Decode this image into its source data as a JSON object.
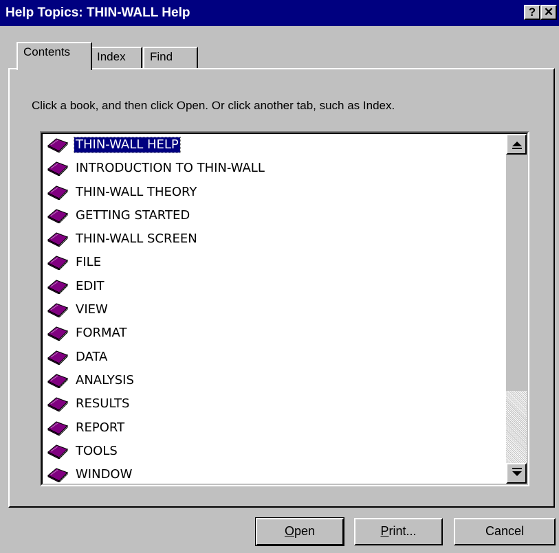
{
  "window": {
    "title": "Help Topics: THIN-WALL Help",
    "help_button": "?",
    "close_button": "✕"
  },
  "tabs": [
    {
      "label": "Contents",
      "active": true
    },
    {
      "label": "Index",
      "active": false
    },
    {
      "label": "Find",
      "active": false
    }
  ],
  "instruction": "Click a book, and then click Open. Or click another tab, such as Index.",
  "topics": [
    {
      "label": "THIN-WALL HELP",
      "icon": "book-icon",
      "selected": true
    },
    {
      "label": "INTRODUCTION TO THIN-WALL",
      "icon": "book-icon"
    },
    {
      "label": "THIN-WALL THEORY",
      "icon": "book-icon"
    },
    {
      "label": "GETTING STARTED",
      "icon": "book-icon"
    },
    {
      "label": "THIN-WALL SCREEN",
      "icon": "book-icon"
    },
    {
      "label": "FILE",
      "icon": "book-icon"
    },
    {
      "label": "EDIT",
      "icon": "book-icon"
    },
    {
      "label": "VIEW",
      "icon": "book-icon"
    },
    {
      "label": "FORMAT",
      "icon": "book-icon"
    },
    {
      "label": "DATA",
      "icon": "book-icon"
    },
    {
      "label": "ANALYSIS",
      "icon": "book-icon"
    },
    {
      "label": "RESULTS",
      "icon": "book-icon"
    },
    {
      "label": "REPORT",
      "icon": "book-icon"
    },
    {
      "label": "TOOLS",
      "icon": "book-icon"
    },
    {
      "label": "WINDOW",
      "icon": "book-icon"
    }
  ],
  "buttons": {
    "open_mnemonic": "O",
    "open_rest": "pen",
    "print_mnemonic": "P",
    "print_rest": "rint...",
    "cancel": "Cancel"
  },
  "colors": {
    "titlebar": "#000080",
    "face": "#c0c0c0",
    "selection": "#000080",
    "book": "#800080"
  }
}
